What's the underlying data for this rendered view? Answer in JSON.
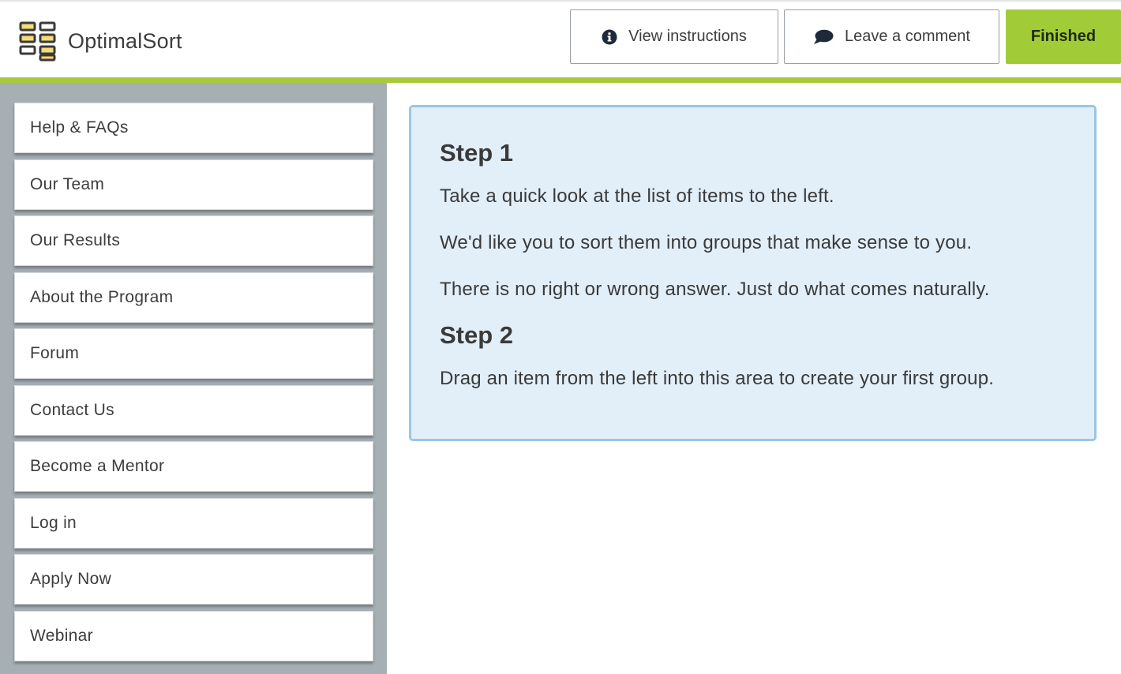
{
  "app": {
    "name": "OptimalSort"
  },
  "header": {
    "view_instructions_label": "View instructions",
    "leave_comment_label": "Leave a comment",
    "finished_label": "Finished"
  },
  "colors": {
    "accent_green": "#a2cb38",
    "header_rule": "#a8cb3c",
    "sidebar_bg": "#a5afb4",
    "dropzone_bg": "#e2eef8",
    "dropzone_border": "#9bc6e4"
  },
  "sidebar": {
    "items": [
      {
        "label": "Help & FAQs"
      },
      {
        "label": "Our Team"
      },
      {
        "label": "Our Results"
      },
      {
        "label": "About the Program"
      },
      {
        "label": "Forum"
      },
      {
        "label": "Contact Us"
      },
      {
        "label": "Become a Mentor"
      },
      {
        "label": "Log in"
      },
      {
        "label": "Apply Now"
      },
      {
        "label": "Webinar"
      }
    ]
  },
  "instructions": {
    "step1_title": "Step 1",
    "step1_lines": [
      "Take a quick look at the list of items to the left.",
      "We'd like you to sort them into groups that make sense to you.",
      "There is no right or wrong answer. Just do what comes naturally."
    ],
    "step2_title": "Step 2",
    "step2_lines": [
      "Drag an item from the left into this area to create your first group."
    ]
  },
  "icons": {
    "logo": "optimalsort-logo-icon",
    "info": "info-icon",
    "comment": "speech-bubble-icon"
  }
}
